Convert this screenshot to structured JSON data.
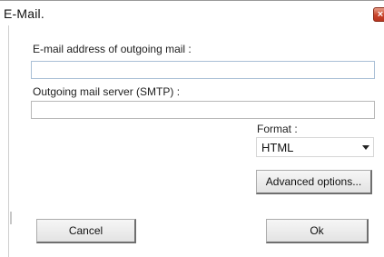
{
  "window": {
    "title": "E-Mail.",
    "close_glyph": "×"
  },
  "form": {
    "address_label": "E-mail address of outgoing mail :",
    "address_value": "",
    "smtp_label": "Outgoing mail server (SMTP) :",
    "smtp_value": "",
    "format_label": "Format :",
    "format_selected": "HTML",
    "advanced_button": "Advanced options..."
  },
  "footer": {
    "cancel_button": "Cancel",
    "ok_button": "Ok"
  }
}
